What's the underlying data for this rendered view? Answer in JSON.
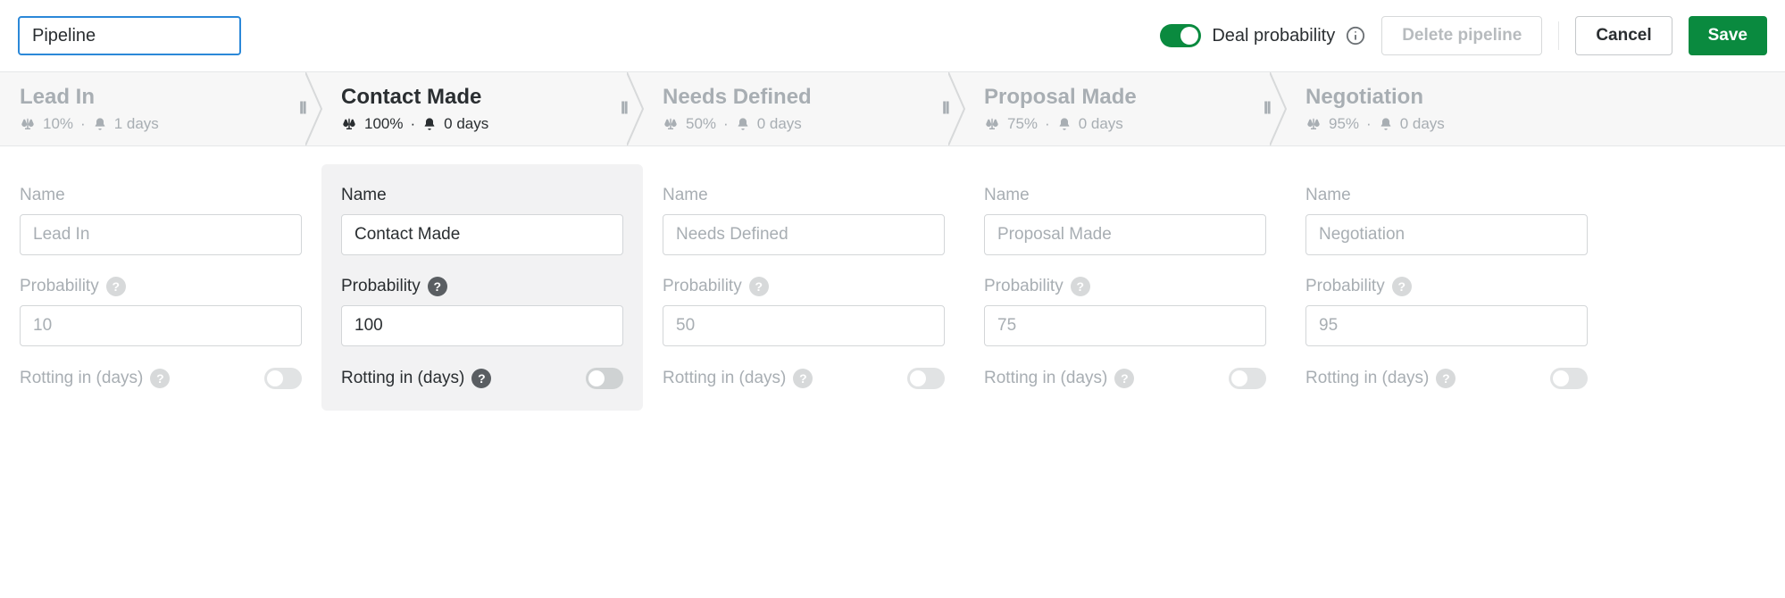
{
  "header": {
    "pipeline_name": "Pipeline",
    "deal_probability_label": "Deal probability",
    "deal_probability_on": true,
    "delete_label": "Delete pipeline",
    "cancel_label": "Cancel",
    "save_label": "Save"
  },
  "labels": {
    "name": "Name",
    "probability": "Probability",
    "rotting": "Rotting in (days)"
  },
  "stages": [
    {
      "title": "Lead In",
      "probability": "10%",
      "days": "1 days",
      "active": false,
      "name_value": "Lead In",
      "prob_value": "10",
      "rotting_on": false
    },
    {
      "title": "Contact Made",
      "probability": "100%",
      "days": "0 days",
      "active": true,
      "name_value": "Contact Made",
      "prob_value": "100",
      "rotting_on": false
    },
    {
      "title": "Needs Defined",
      "probability": "50%",
      "days": "0 days",
      "active": false,
      "name_value": "Needs Defined",
      "prob_value": "50",
      "rotting_on": false
    },
    {
      "title": "Proposal Made",
      "probability": "75%",
      "days": "0 days",
      "active": false,
      "name_value": "Proposal Made",
      "prob_value": "75",
      "rotting_on": false
    },
    {
      "title": "Negotiation",
      "probability": "95%",
      "days": "0 days",
      "active": false,
      "name_value": "Negotiation",
      "prob_value": "95",
      "rotting_on": false
    }
  ]
}
